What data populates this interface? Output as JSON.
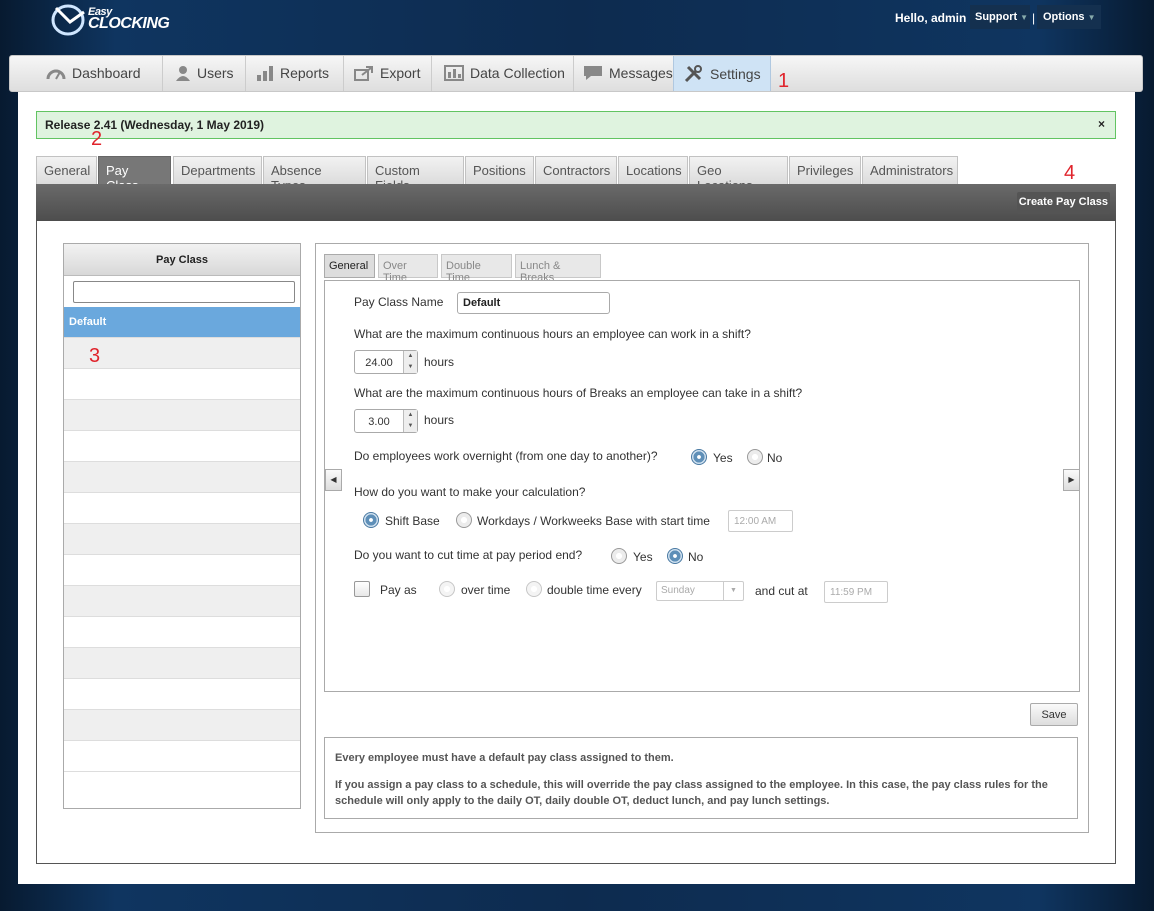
{
  "brand": {
    "logo_text_top": "Easy",
    "logo_text_bottom": "CLOCKING"
  },
  "header": {
    "greeting": "Hello, admin |",
    "support_label": "Support",
    "separator": "|",
    "options_label": "Options"
  },
  "main_nav": {
    "items": [
      {
        "label": "Dashboard",
        "icon": "dashboard-icon"
      },
      {
        "label": "Users",
        "icon": "user-icon"
      },
      {
        "label": "Reports",
        "icon": "bar-chart-icon"
      },
      {
        "label": "Export",
        "icon": "export-icon"
      },
      {
        "label": "Data Collection",
        "icon": "data-collection-icon"
      },
      {
        "label": "Messages",
        "icon": "message-icon"
      },
      {
        "label": "Settings",
        "icon": "wrench-icon",
        "active": true
      }
    ]
  },
  "annotations": [
    "1",
    "2",
    "3",
    "4"
  ],
  "release_banner": {
    "text": "Release 2.41 (Wednesday, 1 May 2019)",
    "close": "×"
  },
  "settings_tabs": [
    "General",
    "Pay Class",
    "Departments",
    "Absence Types",
    "Custom Fields",
    "Positions",
    "Contractors",
    "Locations",
    "Geo Locations",
    "Privileges",
    "Administrators"
  ],
  "toolbar": {
    "create_label": "Create Pay Class"
  },
  "pay_class_list": {
    "header": "Pay Class",
    "search_value": "",
    "items": [
      "Default"
    ]
  },
  "detail_tabs": [
    "General",
    "Over Time",
    "Double Time",
    "Lunch & Breaks"
  ],
  "form": {
    "name_label": "Pay Class Name",
    "name_value": "Default",
    "max_hours_question": "What are the maximum continuous hours an employee can work in a shift?",
    "max_hours_value": "24.00",
    "hours_unit": "hours",
    "max_breaks_question": "What are the maximum continuous hours of Breaks an employee can take in a shift?",
    "max_breaks_value": "3.00",
    "overnight_question": "Do employees work overnight (from one day to another)?",
    "yes": "Yes",
    "no": "No",
    "overnight_selected": "Yes",
    "calc_question": "How do you want to make your calculation?",
    "calc_shift": "Shift Base",
    "calc_workdays": "Workdays / Workweeks Base with start time",
    "calc_selected": "Shift Base",
    "start_time_placeholder": "12:00 AM",
    "cut_question": "Do you want to cut time at pay period end?",
    "cut_selected": "No",
    "pay_as_label": "Pay as",
    "over_time": "over time",
    "double_time_every": "double time every",
    "day_value": "Sunday",
    "cut_at_label": "and cut at",
    "cut_at_placeholder": "11:59 PM"
  },
  "save_label": "Save",
  "notes": [
    "Every employee must have a default pay class assigned to them.",
    "If you assign a pay class to a schedule, this will override the pay class assigned to the employee. In this case, the pay class rules for the schedule will only apply to the daily OT, daily double OT, deduct lunch, and pay lunch settings."
  ]
}
